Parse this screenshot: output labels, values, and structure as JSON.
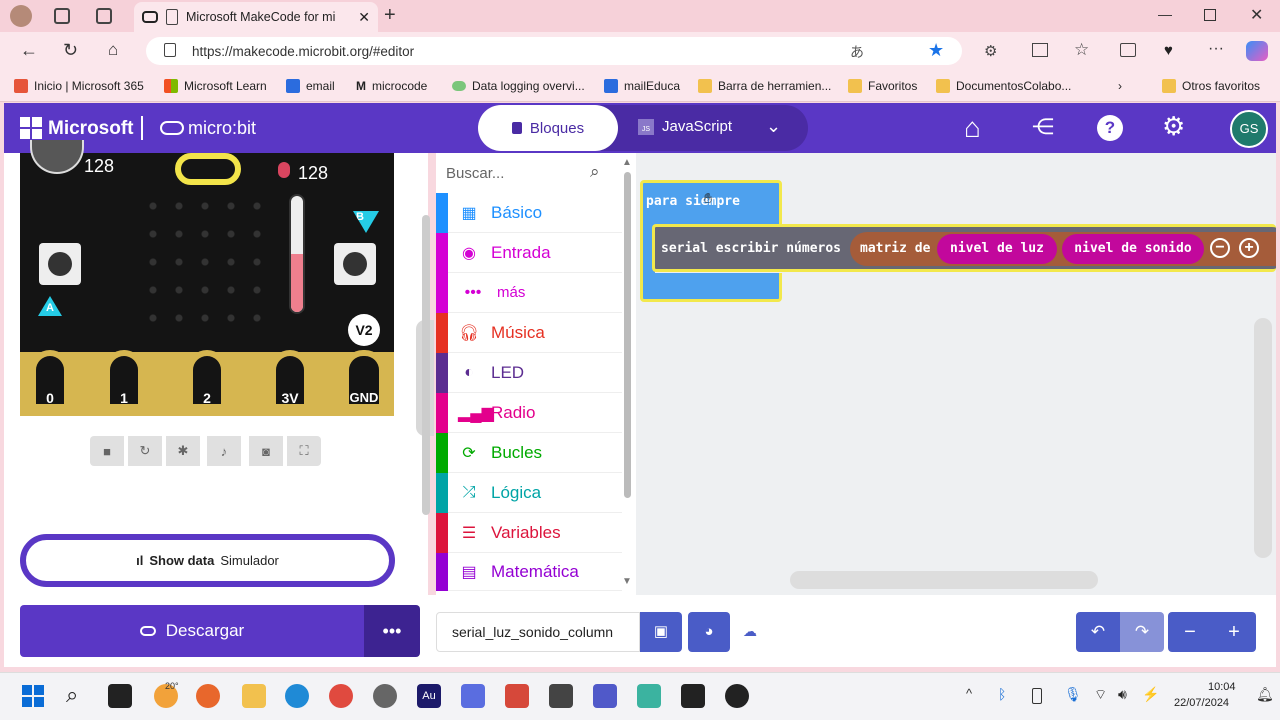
{
  "browser": {
    "tab_title": "Microsoft MakeCode for mi",
    "url": "https://makecode.microbit.org/#editor",
    "favorites": [
      {
        "label": "Inicio | Microsoft 365",
        "icon": "office-icon"
      },
      {
        "label": "Microsoft Learn",
        "icon": "microsoft-logo-icon"
      },
      {
        "label": "email",
        "icon": "mail-icon"
      },
      {
        "label": "microcode",
        "icon": "m-logo-icon"
      },
      {
        "label": "Data logging overvi...",
        "icon": "cloud-icon"
      },
      {
        "label": "mailEduca",
        "icon": "mail-icon"
      },
      {
        "label": "Barra de herramien...",
        "icon": "folder-icon"
      },
      {
        "label": "Favoritos",
        "icon": "folder-icon"
      },
      {
        "label": "DocumentosColabo...",
        "icon": "folder-icon"
      }
    ],
    "other_favorites": "Otros favoritos"
  },
  "header": {
    "brand": "Microsoft",
    "product": "micro:bit",
    "tab_blocks": "Bloques",
    "tab_js": "JavaScript",
    "avatar_initials": "GS"
  },
  "simulator": {
    "light_level": "128",
    "sound_level": "128",
    "version_badge": "V2",
    "button_a": "A",
    "button_b": "B",
    "pins": [
      "0",
      "1",
      "2",
      "3V",
      "GND"
    ],
    "show_data_label": "Show data",
    "show_data_source": "Simulador"
  },
  "toolbox": {
    "search_placeholder": "Buscar...",
    "categories": [
      {
        "label": "Básico",
        "color": "#1e90ff",
        "icon": "grid-icon"
      },
      {
        "label": "Entrada",
        "color": "#d400d4",
        "icon": "target-icon"
      },
      {
        "label": "más",
        "color": "#d400d4",
        "icon": "more-icon"
      },
      {
        "label": "Música",
        "color": "#e63022",
        "icon": "headphones-icon"
      },
      {
        "label": "LED",
        "color": "#5c2d91",
        "icon": "toggle-icon"
      },
      {
        "label": "Radio",
        "color": "#e3008c",
        "icon": "signal-icon"
      },
      {
        "label": "Bucles",
        "color": "#00aa00",
        "icon": "loop-icon"
      },
      {
        "label": "Lógica",
        "color": "#00a4a6",
        "icon": "shuffle-icon"
      },
      {
        "label": "Variables",
        "color": "#dc143c",
        "icon": "list-icon"
      },
      {
        "label": "Matemática",
        "color": "#9400d3",
        "icon": "calculator-icon"
      }
    ]
  },
  "workspace": {
    "forever_label": "para siempre",
    "serial_label": "serial escribir números",
    "matrix_label": "matriz de",
    "light_label": "nivel de luz",
    "sound_label": "nivel de sonido"
  },
  "bottom": {
    "download_label": "Descargar",
    "project_name": "serial_luz_sonido_column"
  },
  "taskbar": {
    "weather": "20°",
    "time": "10:04",
    "date": "22/07/2024"
  }
}
